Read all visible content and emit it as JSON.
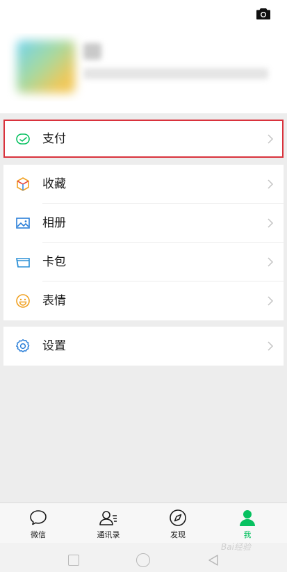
{
  "header": {
    "camera_icon": "camera-icon"
  },
  "menu": {
    "pay": {
      "label": "支付",
      "icon": "pay-icon"
    },
    "items": [
      {
        "label": "收藏",
        "icon": "favorites-icon"
      },
      {
        "label": "相册",
        "icon": "album-icon"
      },
      {
        "label": "卡包",
        "icon": "card-wallet-icon"
      },
      {
        "label": "表情",
        "icon": "sticker-icon"
      }
    ],
    "settings": {
      "label": "设置",
      "icon": "gear-icon"
    }
  },
  "tabs": [
    {
      "label": "微信",
      "icon": "chat-icon",
      "active": false
    },
    {
      "label": "通讯录",
      "icon": "contacts-icon",
      "active": false
    },
    {
      "label": "发现",
      "icon": "discover-icon",
      "active": false
    },
    {
      "label": "我",
      "icon": "me-icon",
      "active": true
    }
  ],
  "watermark": "Bai经验",
  "colors": {
    "accent": "#07c160",
    "highlight": "#d9323c",
    "background": "#ededed"
  }
}
